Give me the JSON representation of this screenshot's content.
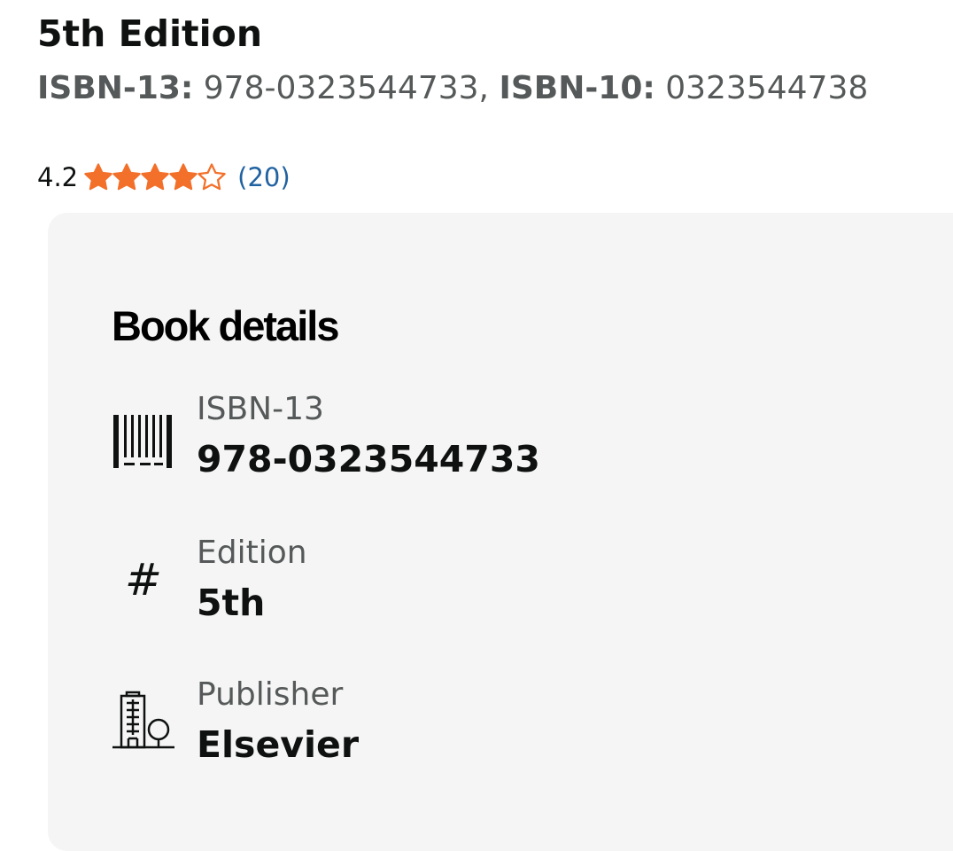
{
  "header": {
    "edition_title": "5th Edition",
    "isbn13_label": "ISBN-13:",
    "isbn13_value": "978-0323544733,",
    "isbn10_label": "ISBN-10:",
    "isbn10_value": "0323544738"
  },
  "rating": {
    "value": "4.2",
    "score": 4.2,
    "max": 5,
    "review_count": "(20)",
    "star_color": "#f3702a"
  },
  "details": {
    "heading": "Book details",
    "panel_color": "#f5f5f5",
    "items": [
      {
        "icon": "barcode-icon",
        "label": "ISBN-13",
        "value": "978-0323544733"
      },
      {
        "icon": "hash-icon",
        "label": "Edition",
        "value": "5th"
      },
      {
        "icon": "building-icon",
        "label": "Publisher",
        "value": "Elsevier"
      }
    ]
  }
}
